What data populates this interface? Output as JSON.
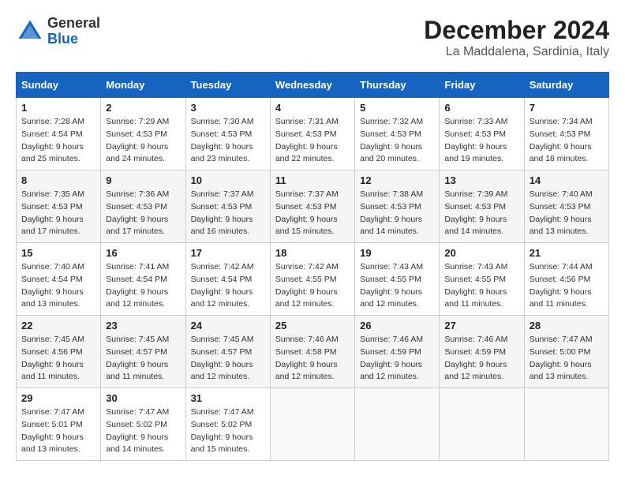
{
  "header": {
    "logo": {
      "line1": "General",
      "line2": "Blue"
    },
    "title": "December 2024",
    "location": "La Maddalena, Sardinia, Italy"
  },
  "calendar": {
    "weekdays": [
      "Sunday",
      "Monday",
      "Tuesday",
      "Wednesday",
      "Thursday",
      "Friday",
      "Saturday"
    ],
    "weeks": [
      [
        {
          "day": "1",
          "sunrise": "Sunrise: 7:28 AM",
          "sunset": "Sunset: 4:54 PM",
          "daylight": "Daylight: 9 hours and 25 minutes."
        },
        {
          "day": "2",
          "sunrise": "Sunrise: 7:29 AM",
          "sunset": "Sunset: 4:53 PM",
          "daylight": "Daylight: 9 hours and 24 minutes."
        },
        {
          "day": "3",
          "sunrise": "Sunrise: 7:30 AM",
          "sunset": "Sunset: 4:53 PM",
          "daylight": "Daylight: 9 hours and 23 minutes."
        },
        {
          "day": "4",
          "sunrise": "Sunrise: 7:31 AM",
          "sunset": "Sunset: 4:53 PM",
          "daylight": "Daylight: 9 hours and 22 minutes."
        },
        {
          "day": "5",
          "sunrise": "Sunrise: 7:32 AM",
          "sunset": "Sunset: 4:53 PM",
          "daylight": "Daylight: 9 hours and 20 minutes."
        },
        {
          "day": "6",
          "sunrise": "Sunrise: 7:33 AM",
          "sunset": "Sunset: 4:53 PM",
          "daylight": "Daylight: 9 hours and 19 minutes."
        },
        {
          "day": "7",
          "sunrise": "Sunrise: 7:34 AM",
          "sunset": "Sunset: 4:53 PM",
          "daylight": "Daylight: 9 hours and 18 minutes."
        }
      ],
      [
        {
          "day": "8",
          "sunrise": "Sunrise: 7:35 AM",
          "sunset": "Sunset: 4:53 PM",
          "daylight": "Daylight: 9 hours and 17 minutes."
        },
        {
          "day": "9",
          "sunrise": "Sunrise: 7:36 AM",
          "sunset": "Sunset: 4:53 PM",
          "daylight": "Daylight: 9 hours and 17 minutes."
        },
        {
          "day": "10",
          "sunrise": "Sunrise: 7:37 AM",
          "sunset": "Sunset: 4:53 PM",
          "daylight": "Daylight: 9 hours and 16 minutes."
        },
        {
          "day": "11",
          "sunrise": "Sunrise: 7:37 AM",
          "sunset": "Sunset: 4:53 PM",
          "daylight": "Daylight: 9 hours and 15 minutes."
        },
        {
          "day": "12",
          "sunrise": "Sunrise: 7:38 AM",
          "sunset": "Sunset: 4:53 PM",
          "daylight": "Daylight: 9 hours and 14 minutes."
        },
        {
          "day": "13",
          "sunrise": "Sunrise: 7:39 AM",
          "sunset": "Sunset: 4:53 PM",
          "daylight": "Daylight: 9 hours and 14 minutes."
        },
        {
          "day": "14",
          "sunrise": "Sunrise: 7:40 AM",
          "sunset": "Sunset: 4:53 PM",
          "daylight": "Daylight: 9 hours and 13 minutes."
        }
      ],
      [
        {
          "day": "15",
          "sunrise": "Sunrise: 7:40 AM",
          "sunset": "Sunset: 4:54 PM",
          "daylight": "Daylight: 9 hours and 13 minutes."
        },
        {
          "day": "16",
          "sunrise": "Sunrise: 7:41 AM",
          "sunset": "Sunset: 4:54 PM",
          "daylight": "Daylight: 9 hours and 12 minutes."
        },
        {
          "day": "17",
          "sunrise": "Sunrise: 7:42 AM",
          "sunset": "Sunset: 4:54 PM",
          "daylight": "Daylight: 9 hours and 12 minutes."
        },
        {
          "day": "18",
          "sunrise": "Sunrise: 7:42 AM",
          "sunset": "Sunset: 4:55 PM",
          "daylight": "Daylight: 9 hours and 12 minutes."
        },
        {
          "day": "19",
          "sunrise": "Sunrise: 7:43 AM",
          "sunset": "Sunset: 4:55 PM",
          "daylight": "Daylight: 9 hours and 12 minutes."
        },
        {
          "day": "20",
          "sunrise": "Sunrise: 7:43 AM",
          "sunset": "Sunset: 4:55 PM",
          "daylight": "Daylight: 9 hours and 11 minutes."
        },
        {
          "day": "21",
          "sunrise": "Sunrise: 7:44 AM",
          "sunset": "Sunset: 4:56 PM",
          "daylight": "Daylight: 9 hours and 11 minutes."
        }
      ],
      [
        {
          "day": "22",
          "sunrise": "Sunrise: 7:45 AM",
          "sunset": "Sunset: 4:56 PM",
          "daylight": "Daylight: 9 hours and 11 minutes."
        },
        {
          "day": "23",
          "sunrise": "Sunrise: 7:45 AM",
          "sunset": "Sunset: 4:57 PM",
          "daylight": "Daylight: 9 hours and 11 minutes."
        },
        {
          "day": "24",
          "sunrise": "Sunrise: 7:45 AM",
          "sunset": "Sunset: 4:57 PM",
          "daylight": "Daylight: 9 hours and 12 minutes."
        },
        {
          "day": "25",
          "sunrise": "Sunrise: 7:46 AM",
          "sunset": "Sunset: 4:58 PM",
          "daylight": "Daylight: 9 hours and 12 minutes."
        },
        {
          "day": "26",
          "sunrise": "Sunrise: 7:46 AM",
          "sunset": "Sunset: 4:59 PM",
          "daylight": "Daylight: 9 hours and 12 minutes."
        },
        {
          "day": "27",
          "sunrise": "Sunrise: 7:46 AM",
          "sunset": "Sunset: 4:59 PM",
          "daylight": "Daylight: 9 hours and 12 minutes."
        },
        {
          "day": "28",
          "sunrise": "Sunrise: 7:47 AM",
          "sunset": "Sunset: 5:00 PM",
          "daylight": "Daylight: 9 hours and 13 minutes."
        }
      ],
      [
        {
          "day": "29",
          "sunrise": "Sunrise: 7:47 AM",
          "sunset": "Sunset: 5:01 PM",
          "daylight": "Daylight: 9 hours and 13 minutes."
        },
        {
          "day": "30",
          "sunrise": "Sunrise: 7:47 AM",
          "sunset": "Sunset: 5:02 PM",
          "daylight": "Daylight: 9 hours and 14 minutes."
        },
        {
          "day": "31",
          "sunrise": "Sunrise: 7:47 AM",
          "sunset": "Sunset: 5:02 PM",
          "daylight": "Daylight: 9 hours and 15 minutes."
        },
        null,
        null,
        null,
        null
      ]
    ]
  }
}
